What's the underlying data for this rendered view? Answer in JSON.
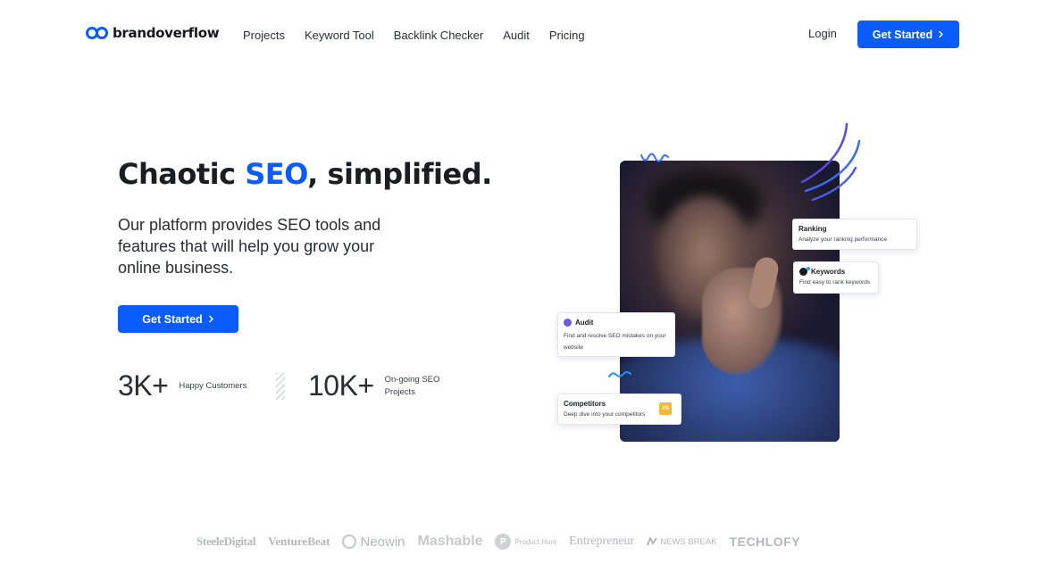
{
  "nav": {
    "brand": "brandoverflow",
    "items": [
      "Projects",
      "Keyword Tool",
      "Backlink Checker",
      "Audit",
      "Pricing"
    ],
    "login": "Login",
    "cta": "Get Started"
  },
  "hero": {
    "title_pre": "Chaotic ",
    "title_highlight": "SEO",
    "title_post": ", simplified.",
    "subtitle": "Our platform provides SEO tools and features that will help you grow your online business.",
    "cta": "Get Started",
    "stats": [
      {
        "value": "3K+",
        "label": "Happy Customers"
      },
      {
        "value": "10K+",
        "label": "On-going SEO Projects"
      }
    ]
  },
  "cards": {
    "ranking": {
      "title": "Ranking",
      "desc": "Analyze your ranking performance"
    },
    "keywords": {
      "title": "Keywords",
      "desc": "Find easy to rank keywords"
    },
    "audit": {
      "title": "Audit",
      "desc": "Find and resolve SEO mistakes on your website"
    },
    "competitors": {
      "title": "Competitors",
      "desc": "Deep dive into your competitors",
      "badge": "VS"
    }
  },
  "logos": {
    "steele": "SteeleDigital",
    "venturebeat": "VentureBeat",
    "neowin": "Neowin",
    "mashable": "Mashable",
    "producthunt": "Product Hunt",
    "producthunt_mark": "P",
    "entrepreneur": "Entrepreneur",
    "newsbreak": "NEWS BREAK",
    "techlofy": "TECHLOFY"
  },
  "colors": {
    "accent": "#0b5cff",
    "text": "#1b1d24",
    "muted_logo": "#b4b6bd"
  },
  "icons": {
    "chevron": "chevron-right-icon",
    "logo": "infinity-logo-icon"
  }
}
